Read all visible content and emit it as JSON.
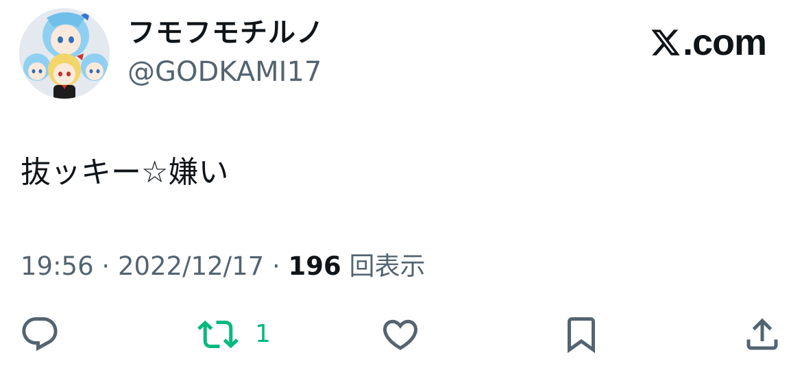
{
  "author": {
    "display_name": "フモフモチルノ",
    "handle": "@GODKAMI17",
    "avatar": "plush-dolls-photo"
  },
  "brand": {
    "label": ".com",
    "icon": "x-logo-icon"
  },
  "tweet": {
    "text": "抜ッキー☆嫌い"
  },
  "meta": {
    "time": "19:56",
    "date": "2022/12/17",
    "separator": "·",
    "views_count": "196",
    "views_label": "回表示"
  },
  "actions": {
    "reply_icon": "reply-icon",
    "retweet_icon": "retweet-icon",
    "retweet_count": "1",
    "like_icon": "heart-icon",
    "bookmark_icon": "bookmark-icon",
    "share_icon": "share-icon"
  },
  "colors": {
    "text": "#0f1419",
    "secondary": "#536471",
    "retweet": "#00ba7c",
    "background": "#ffffff"
  }
}
